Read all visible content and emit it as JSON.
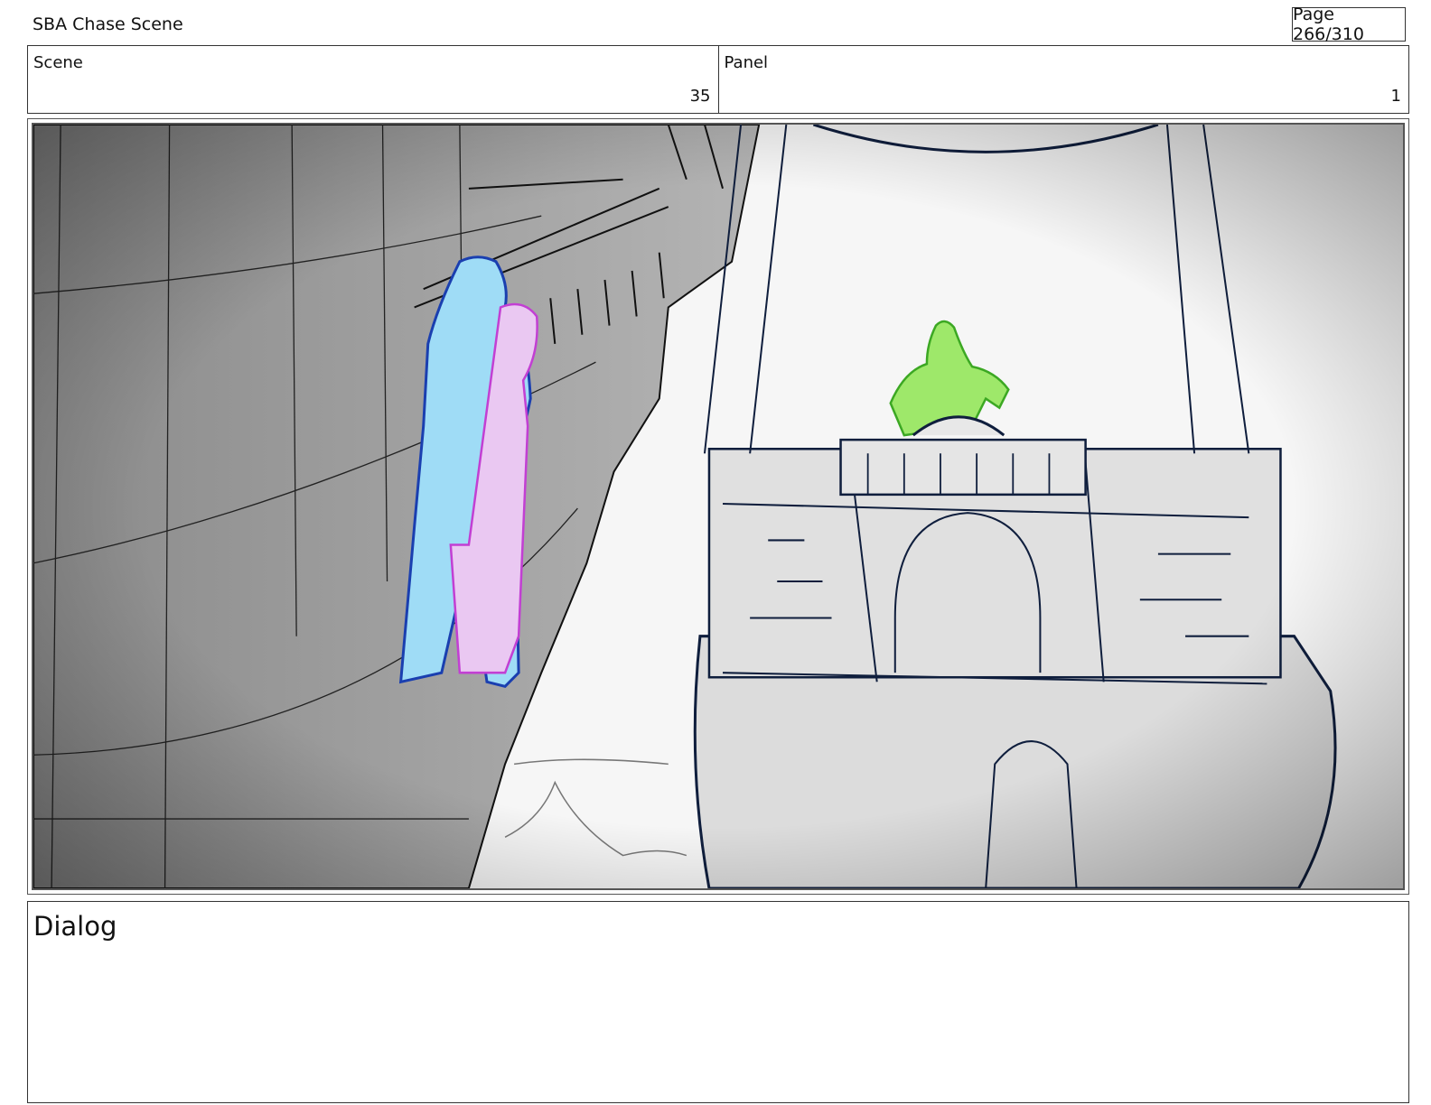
{
  "header": {
    "title": "SBA Chase Scene",
    "page": "Page 266/310"
  },
  "info": {
    "scene_label": "Scene",
    "scene_value": "35",
    "panel_label": "Panel",
    "panel_value": "1"
  },
  "frame": {
    "image_name": "storyboard-sketch"
  },
  "dialog": {
    "label": "Dialog"
  }
}
